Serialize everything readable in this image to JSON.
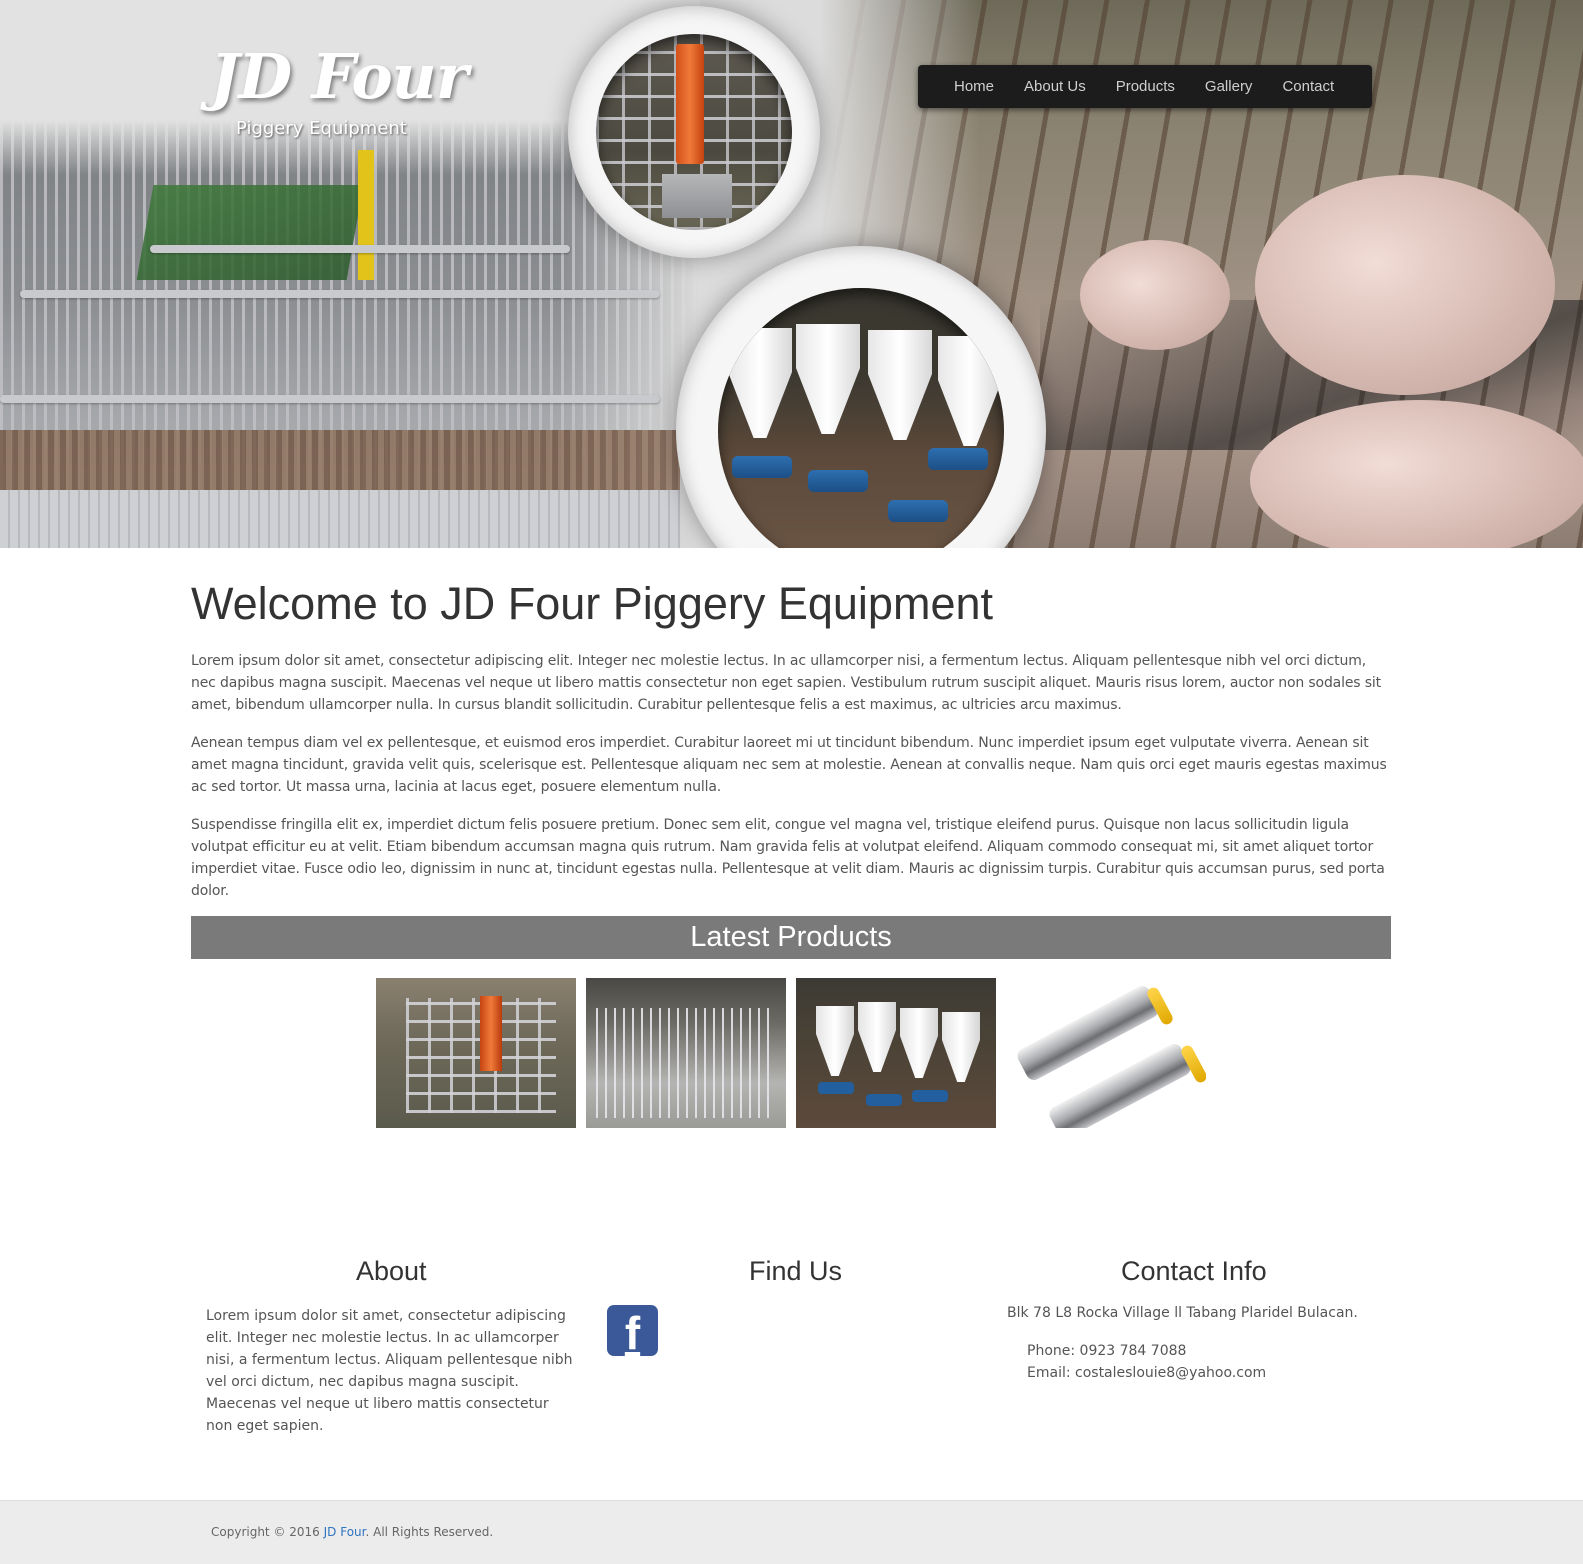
{
  "brand": {
    "title": "JD Four",
    "subtitle": "Piggery Equipment"
  },
  "nav": {
    "items": [
      "Home",
      "About Us",
      "Products",
      "Gallery",
      "Contact"
    ]
  },
  "welcome": {
    "heading": "Welcome to JD Four Piggery Equipment",
    "paragraphs": [
      "Lorem ipsum dolor sit amet, consectetur adipiscing elit. Integer nec molestie lectus. In ac ullamcorper nisi, a fermentum lectus. Aliquam pellentesque nibh vel orci dictum, nec dapibus magna suscipit. Maecenas vel neque ut libero mattis consectetur non eget sapien. Vestibulum rutrum suscipit aliquet. Mauris risus lorem, auctor non sodales sit amet, bibendum ullamcorper nulla. In cursus blandit sollicitudin. Curabitur pellentesque felis a est maximus, ac ultricies arcu maximus.",
      "Aenean tempus diam vel ex pellentesque, et euismod eros imperdiet. Curabitur laoreet mi ut tincidunt bibendum. Nunc imperdiet ipsum eget vulputate viverra. Aenean sit amet magna tincidunt, gravida velit quis, scelerisque est. Pellentesque aliquam nec sem at molestie. Aenean at convallis neque. Nam quis orci eget mauris egestas maximus ac sed tortor. Ut massa urna, lacinia at lacus eget, posuere elementum nulla.",
      "Suspendisse fringilla elit ex, imperdiet dictum felis posuere pretium. Donec sem elit, congue vel magna vel, tristique eleifend purus. Quisque non lacus sollicitudin ligula volutpat efficitur eu at velit. Etiam bibendum accumsan magna quis rutrum. Nam gravida felis at volutpat eleifend. Aliquam commodo consequat mi, sit amet aliquet tortor imperdiet vitae. Fusce odio leo, dignissim in nunc at, tincidunt egestas nulla. Pellentesque at velit diam. Mauris ac dignissim turpis. Curabitur quis accumsan purus, sed porta dolor."
    ]
  },
  "latest_products": {
    "heading": "Latest Products"
  },
  "about": {
    "heading": "About",
    "text": "Lorem ipsum dolor sit amet, consectetur adipiscing elit. Integer nec molestie lectus. In ac ullamcorper nisi, a fermentum lectus. Aliquam pellentesque nibh vel orci dictum, nec dapibus magna suscipit. Maecenas vel neque ut libero mattis consectetur non eget sapien."
  },
  "find_us": {
    "heading": "Find Us",
    "icon": "facebook-icon",
    "icon_glyph": "f"
  },
  "contact": {
    "heading": "Contact Info",
    "address": "Blk 78 L8 Rocka Village ll Tabang Plaridel Bulacan.",
    "phone": "Phone: 0923 784 7088",
    "email": "Email: costaleslouie8@yahoo.com"
  },
  "footer": {
    "copyright_prefix": "Copyright © 2016 ",
    "link": "JD Four",
    "copyright_suffix": ". All Rights Reserved."
  },
  "colors": {
    "nav_bg": "#1c1c1c",
    "latest_bar": "#7a7a7a",
    "facebook": "#3b5998",
    "footer_link": "#2f74c0"
  }
}
